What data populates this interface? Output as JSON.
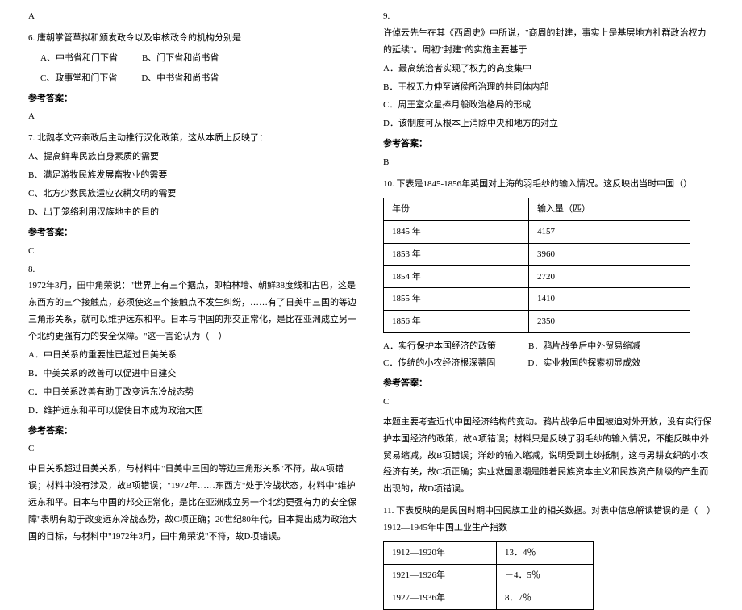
{
  "left": {
    "a_prev": "A",
    "q6": {
      "text": "6. 唐朝掌管草拟和颁发政令以及审核政令的机构分别是",
      "opts": [
        "A、中书省和门下省",
        "B、门下省和尚书省",
        "C、政事堂和门下省",
        "D、中书省和尚书省"
      ],
      "ans_label": "参考答案：",
      "ans": "A"
    },
    "q7": {
      "text": "7. 北魏孝文帝亲政后主动推行汉化政策，这从本质上反映了：",
      "opts": [
        "A、提高鲜卑民族自身素质的需要",
        "B、满足游牧民族发展畜牧业的需要",
        "C、北方少数民族适应农耕文明的需要",
        "D、出于笼络利用汉族地主的目的"
      ],
      "ans_label": "参考答案：",
      "ans": "C"
    },
    "q8": {
      "num": "8.",
      "text": "1972年3月，田中角荣说：\"世界上有三个据点，即柏林墙、朝鲜38度线和古巴，这是东西方的三个接触点，必须使这三个接触点不发生纠纷，……有了日美中三国的等边三角形关系，就可以维护远东和平。日本与中国的邦交正常化，是比在亚洲成立另一个北约更强有力的安全保障。\"这一言论认为（　）",
      "opts": [
        "A．中日关系的重要性已超过日美关系",
        "B．中美关系的改善可以促进中日建交",
        "C．中日关系改善有助于改变远东冷战态势",
        "D．维护远东和平可以促使日本成为政治大国"
      ],
      "ans_label": "参考答案：",
      "ans": "C",
      "explain": "中日关系超过日美关系，与材料中\"日美中三国的等边三角形关系\"不符，故A项错误；材料中没有涉及，故B项错误；\"1972年……东西方\"处于冷战状态，材料中\"维护远东和平。日本与中国的邦交正常化，是比在亚洲成立另一个北约更强有力的安全保障\"表明有助于改变远东冷战态势，故C项正确；20世纪80年代，日本提出成为政治大国的目标，与材料中\"1972年3月，田中角荣说\"不符，故D项错误。"
    }
  },
  "right": {
    "q9": {
      "num": "9.",
      "text": "许倬云先生在其《西周史》中所说，\"商周的封建，事实上是基层地方社群政治权力的延续\"。周初\"封建\"的实施主要基于",
      "opts": [
        "A．最高统治者实现了权力的高度集中",
        "B．王权无力伸至诸侯所治理的共同体内部",
        "C．周王室众星捧月般政治格局的形成",
        "D．该制度可从根本上消除中央和地方的对立"
      ],
      "ans_label": "参考答案：",
      "ans": "B"
    },
    "q10": {
      "text": "10. 下表是1845-1856年英国对上海的羽毛纱的输入情况。这反映出当时中国（）",
      "th1": "年份",
      "th2": "输入量（匹）",
      "rows": [
        [
          "1845 年",
          "4157"
        ],
        [
          "1853 年",
          "3960"
        ],
        [
          "1854 年",
          "2720"
        ],
        [
          "1855 年",
          "1410"
        ],
        [
          "1856 年",
          "2350"
        ]
      ],
      "ab": [
        "A．实行保护本国经济的政策",
        "B．鸦片战争后中外贸易缩减"
      ],
      "cd": [
        "C．传统的小农经济根深蒂固",
        "D．实业救国的探索初显成效"
      ],
      "ans_label": "参考答案：",
      "ans": "C",
      "explain": "本题主要考查近代中国经济结构的变动。鸦片战争后中国被迫对外开放，没有实行保护本国经济的政策，故A项错误；材料只是反映了羽毛纱的输入情况，不能反映中外贸易缩减，故B项错误；洋纱的输入缩减，说明受到土纱抵制，这与男耕女织的小农经济有关，故C项正确；实业救国思潮是随着民族资本主义和民族资产阶级的产生而出现的，故D项错误。"
    },
    "q11": {
      "text": "11. 下表反映的是民国时期中国民族工业的相关数据。对表中信息解读错误的是（　）",
      "subtitle": "1912—1945年中国工业生产指数",
      "rows": [
        [
          "1912—1920年",
          "13．4％"
        ],
        [
          "1921—1926年",
          "－4．5％"
        ],
        [
          "1927—1936年",
          "8．7％"
        ]
      ]
    }
  }
}
